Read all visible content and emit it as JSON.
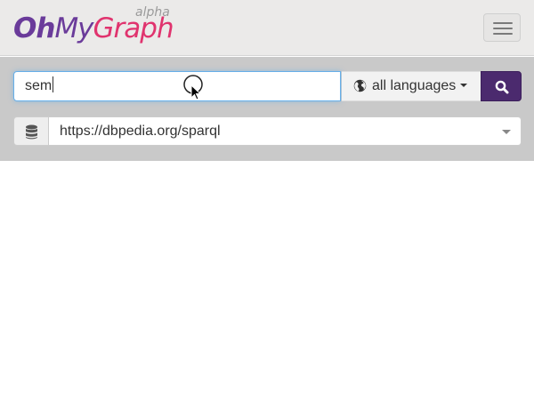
{
  "brand": {
    "part1": "Oh",
    "part2": "My",
    "part3": "Graph",
    "badge": "alpha",
    "colors": {
      "purple": "#6a3b9a",
      "pink": "#e0336e",
      "badge": "#9a9a9a"
    }
  },
  "navbar": {
    "menu_icon": "hamburger-icon"
  },
  "search": {
    "value": "sem",
    "language_label": "all languages",
    "language_icon": "globe-icon",
    "search_icon": "search-icon",
    "accent_color": "#4b2a6e"
  },
  "endpoint": {
    "icon": "database-icon",
    "value": "https://dbpedia.org/sparql"
  }
}
